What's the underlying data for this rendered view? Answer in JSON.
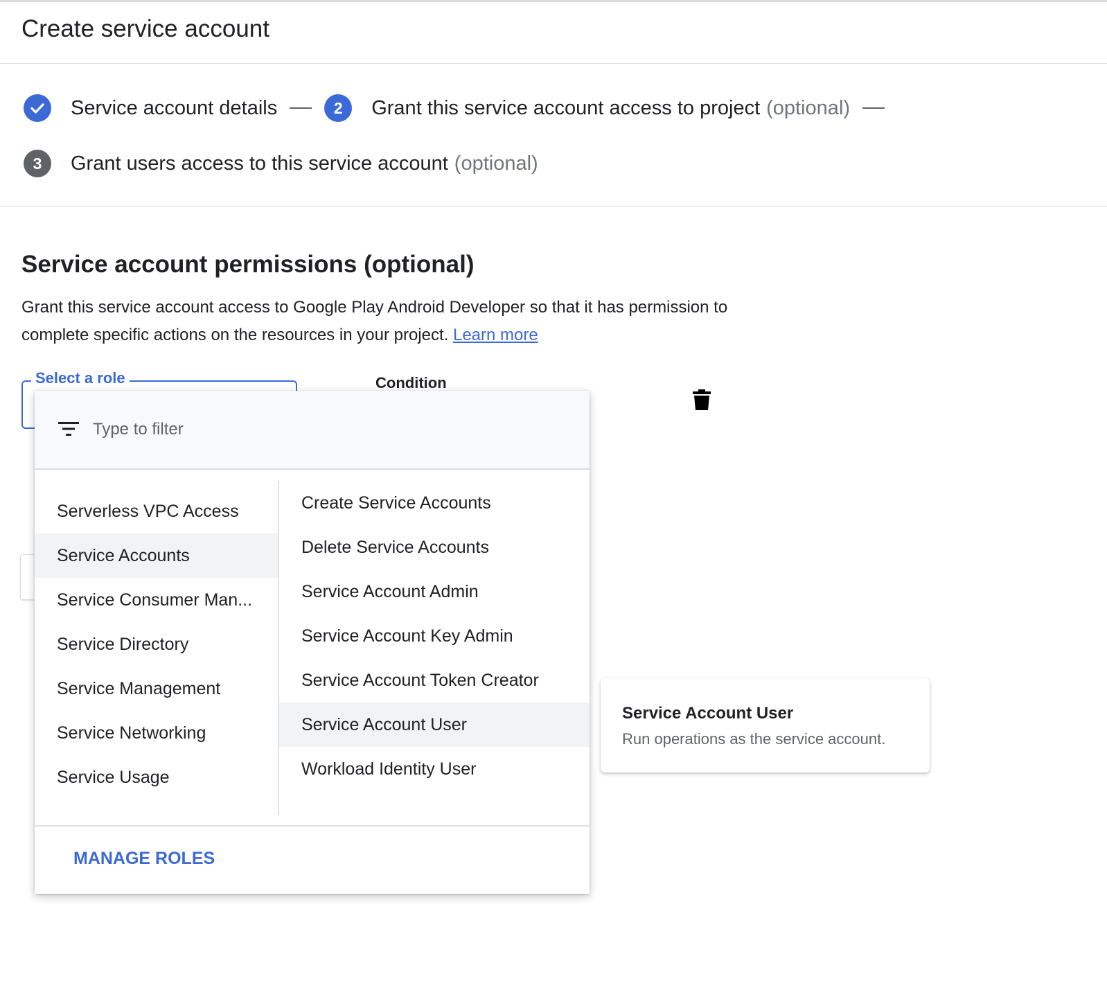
{
  "header": {
    "title": "Create service account"
  },
  "stepper": {
    "steps": [
      {
        "number": "",
        "label": "Service account details",
        "optional": "",
        "status": "done"
      },
      {
        "number": "2",
        "label": "Grant this service account access to project",
        "optional": "(optional)",
        "status": "active"
      },
      {
        "number": "3",
        "label": "Grant users access to this service account",
        "optional": "(optional)",
        "status": "pending"
      }
    ]
  },
  "permissions": {
    "title": "Service account permissions (optional)",
    "description": "Grant this service account access to Google Play Android Developer so that it has permission to complete specific actions on the resources in your project.",
    "learn_more": "Learn more"
  },
  "role_field": {
    "label": "Select a role",
    "value": ""
  },
  "condition": {
    "label": "Condition"
  },
  "dropdown": {
    "filter_placeholder": "Type to filter",
    "categories": [
      {
        "label": "Serverless VPC Access"
      },
      {
        "label": "Service Accounts",
        "selected": true
      },
      {
        "label": "Service Consumer Man..."
      },
      {
        "label": "Service Directory"
      },
      {
        "label": "Service Management"
      },
      {
        "label": "Service Networking"
      },
      {
        "label": "Service Usage"
      }
    ],
    "roles": [
      {
        "label": "Create Service Accounts"
      },
      {
        "label": "Delete Service Accounts"
      },
      {
        "label": "Service Account Admin"
      },
      {
        "label": "Service Account Key Admin"
      },
      {
        "label": "Service Account Token Creator"
      },
      {
        "label": "Service Account User",
        "highlighted": true
      },
      {
        "label": "Workload Identity User"
      }
    ],
    "manage_roles": "MANAGE ROLES"
  },
  "tooltip": {
    "title": "Service Account User",
    "description": "Run operations as the service account."
  },
  "icons": {
    "step_done": "check-icon",
    "filter": "filter-list-icon",
    "delete": "trash-icon"
  },
  "colors": {
    "accent": "#3b6ad6",
    "pending_step": "#5f6368",
    "selected_row": "#f1f3f4",
    "muted_text": "#70757a"
  }
}
